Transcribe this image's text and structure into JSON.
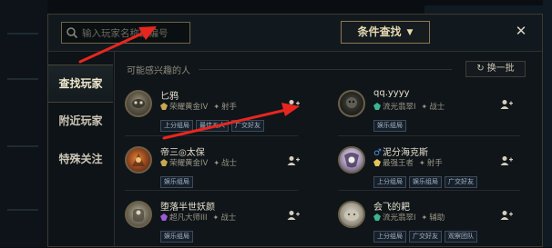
{
  "search": {
    "placeholder": "输入玩家名称或编号"
  },
  "toolbar": {
    "filter_label": "条件查找",
    "close_label": "✕"
  },
  "sidebar": {
    "items": [
      {
        "label": "查找玩家",
        "active": true
      },
      {
        "label": "附近玩家",
        "active": false
      },
      {
        "label": "特殊关注",
        "active": false
      }
    ]
  },
  "main": {
    "section_title": "可能感兴趣的人",
    "refresh_label": "换一批",
    "players": [
      {
        "name": "匕鸦",
        "gender": "",
        "rank": "荣耀黄金IV",
        "role": "射手",
        "tags": [
          "上分组局",
          "最佳五人",
          "广交好友"
        ]
      },
      {
        "name": "qq.yyyy",
        "gender": "",
        "rank": "流光翡翠I",
        "role": "战士",
        "tags": [
          "娱乐组局"
        ]
      },
      {
        "name": "帝三◎太保",
        "gender": "",
        "rank": "荣耀黄金IV",
        "role": "战士",
        "tags": [
          "娱乐组局"
        ]
      },
      {
        "name": "泥分海克斯",
        "gender": "♂",
        "rank": "最强王者",
        "role": "射手",
        "tags": [
          "上分组局",
          "娱乐组局",
          "广交好友"
        ]
      },
      {
        "name": "堕落半世妖颜",
        "gender": "",
        "rank": "超凡大师III",
        "role": "战士",
        "tags": [
          "娱乐组局"
        ]
      },
      {
        "name": "会飞的耙",
        "gender": "",
        "rank": "流光翡翠I",
        "role": "辅助",
        "tags": [
          "上分组局",
          "广交好友",
          "观察团队"
        ]
      }
    ]
  },
  "colors": {
    "accent_gold": "#c8aa6e",
    "rank_gold": "#c9a653",
    "rank_emerald": "#3bb58f",
    "rank_master": "#9d5cd6",
    "rank_challenger": "#e3c35a",
    "annotation_red": "#e8261f"
  },
  "icons": {
    "search": "search-icon",
    "refresh": "refresh-icon",
    "add_friend": "add-friend-icon",
    "close": "close-icon",
    "caret": "chevron-down-icon"
  }
}
